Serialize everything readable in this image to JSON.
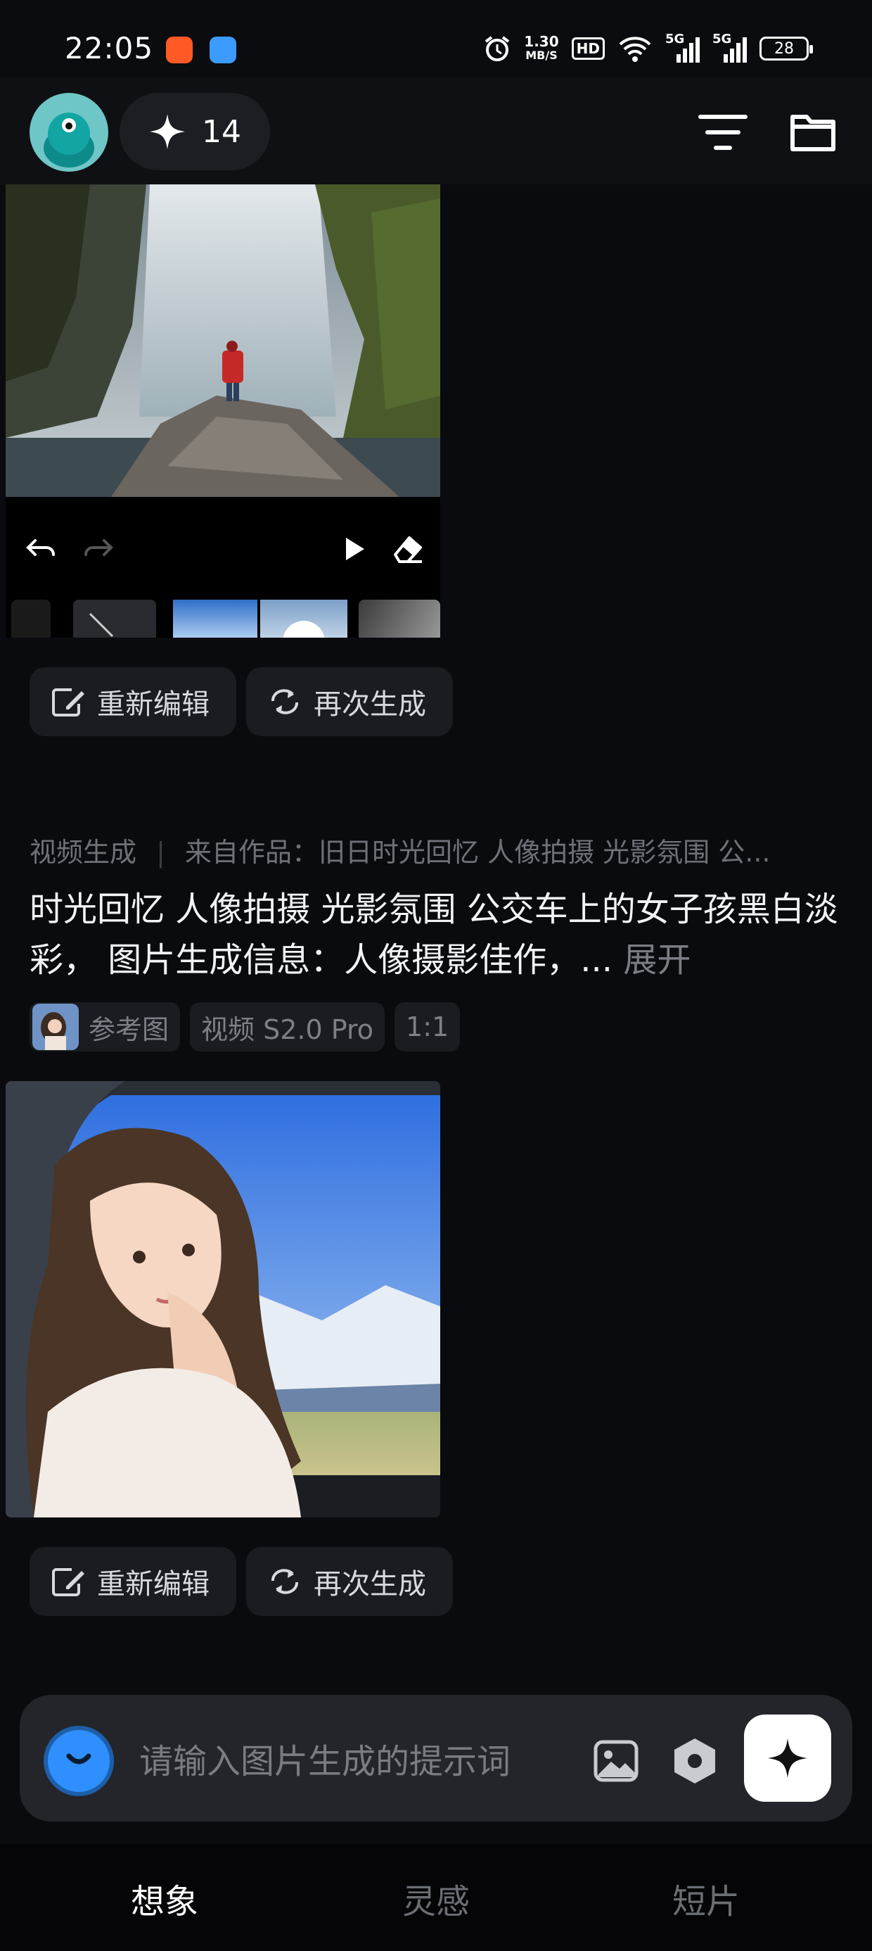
{
  "status_bar": {
    "time": "22:05",
    "net_speed_value": "1.30",
    "net_speed_unit": "MB/S",
    "hd_label": "HD",
    "signal_1": "5G",
    "signal_2": "5G",
    "battery": "28",
    "icons": [
      "alarm-icon",
      "hd-icon",
      "wifi-icon",
      "signal-icon",
      "signal-icon",
      "battery-icon"
    ]
  },
  "header": {
    "credits": "14",
    "icons": [
      "sparkle-icon",
      "filter-icon",
      "folder-icon"
    ]
  },
  "card1": {
    "editor_icons": [
      "undo-icon",
      "redo-icon",
      "play-icon",
      "eraser-icon"
    ],
    "actions": {
      "reedit": "重新编辑",
      "regenerate": "再次生成"
    }
  },
  "card2": {
    "type_label": "视频生成",
    "source_label": "来自作品：旧日时光回忆  人像拍摄  光影氛围  公...",
    "prompt": "时光回忆 人像拍摄 光影氛围 公交车上的女子孩黑白淡彩， 图片生成信息：人像摄影佳作，...",
    "expand": "展开",
    "tags": {
      "reference": "参考图",
      "model": "视频 S2.0 Pro",
      "ratio": "1:1"
    },
    "actions": {
      "reedit": "重新编辑",
      "regenerate": "再次生成"
    }
  },
  "composer": {
    "placeholder": "请输入图片生成的提示词",
    "icons": [
      "chevron-down-icon",
      "image-icon",
      "settings-hex-icon",
      "sparkle-icon"
    ]
  },
  "tabs": [
    "想象",
    "灵感",
    "短片"
  ],
  "colors": {
    "accent": "#2f8fff",
    "background": "#0a0b0f",
    "active_tab": "#ffffff",
    "inactive_tab": "#6b6e75"
  }
}
